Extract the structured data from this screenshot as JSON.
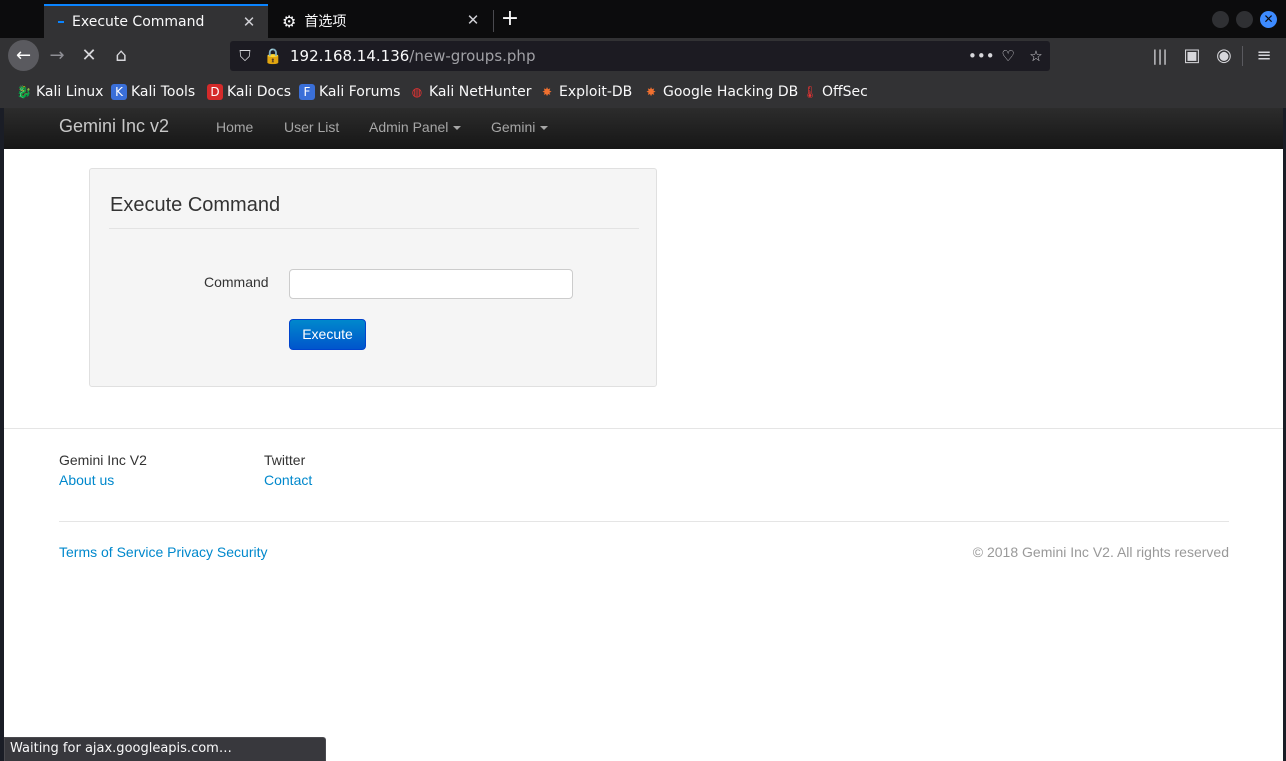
{
  "tabs": [
    {
      "label": "Execute Command",
      "active": true
    },
    {
      "label": "首选项",
      "active": false
    }
  ],
  "toolbar": {
    "url_host": "192.168.14.136",
    "url_path": "/new-groups.php"
  },
  "bookmarks": [
    {
      "label": "Kali Linux",
      "icon": "kali-dragon-icon"
    },
    {
      "label": "Kali Tools",
      "icon": "kali-tools-icon"
    },
    {
      "label": "Kali Docs",
      "icon": "kali-docs-icon"
    },
    {
      "label": "Kali Forums",
      "icon": "kali-forums-icon"
    },
    {
      "label": "Kali NetHunter",
      "icon": "nethunter-icon"
    },
    {
      "label": "Exploit-DB",
      "icon": "exploit-db-icon"
    },
    {
      "label": "Google Hacking DB",
      "icon": "ghdb-icon"
    },
    {
      "label": "OffSec",
      "icon": "offsec-icon"
    }
  ],
  "site": {
    "brand": "Gemini Inc v2",
    "nav": [
      "Home",
      "User List",
      "Admin Panel",
      "Gemini"
    ]
  },
  "form": {
    "title": "Execute Command",
    "command_label": "Command",
    "command_value": "",
    "execute_label": "Execute"
  },
  "footer": {
    "col1_title": "Gemini Inc V2",
    "col1_link": "About us",
    "col2_title": "Twitter",
    "col2_link": "Contact",
    "links": "Terms of Service Privacy Security",
    "copyright": "© 2018 Gemini Inc V2. All rights reserved"
  },
  "status": "Waiting for ajax.googleapis.com…",
  "colors": {
    "accent": "#0a84ff",
    "link": "#0088cc",
    "button": "#0066cc"
  }
}
